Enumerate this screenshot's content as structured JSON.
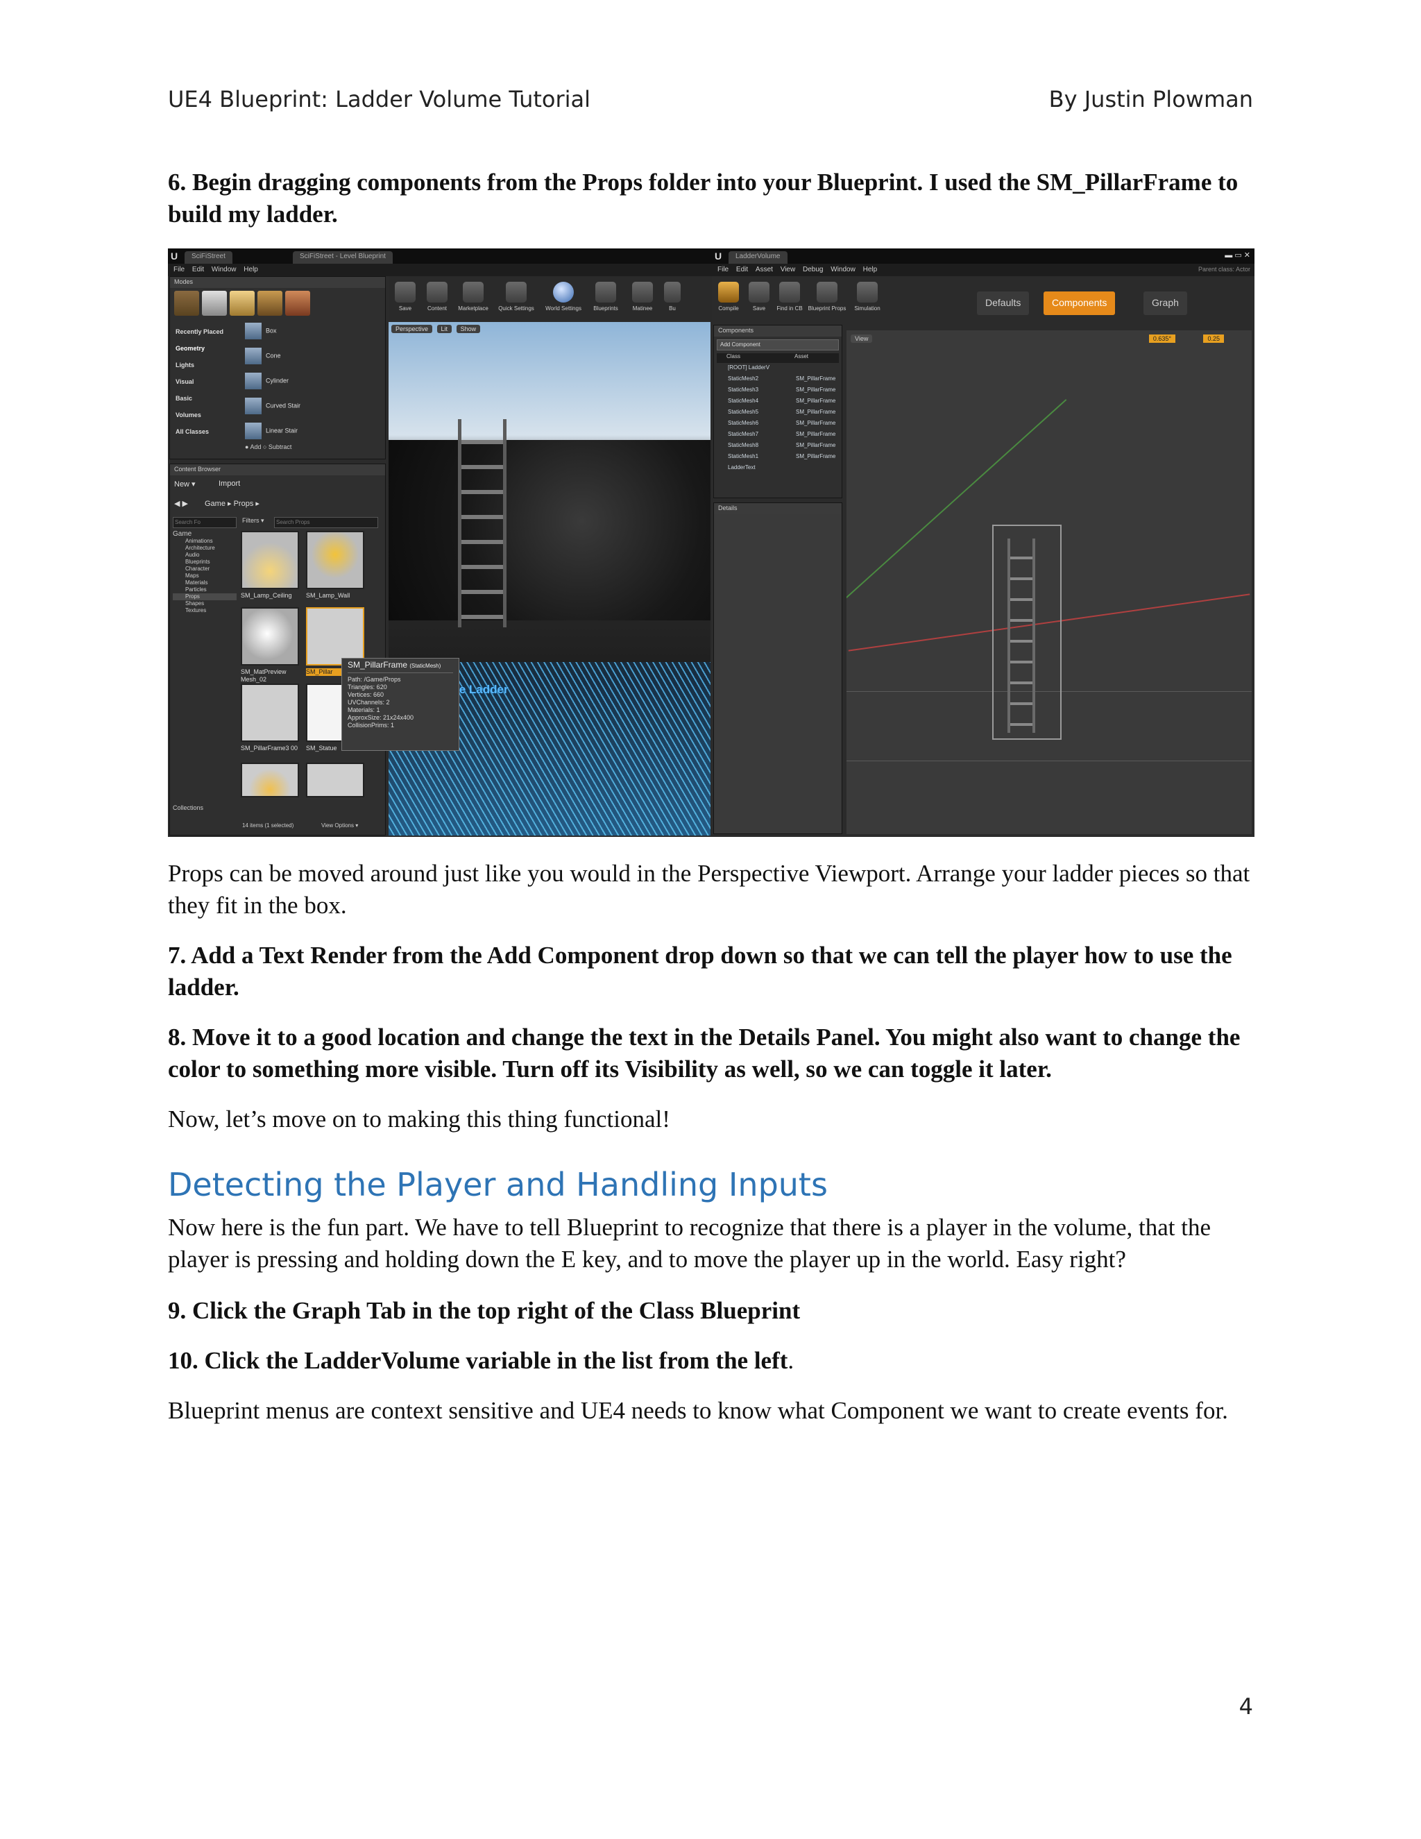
{
  "header": {
    "title": "UE4 Blueprint: Ladder Volume Tutorial",
    "author": "By Justin Plowman"
  },
  "step6": "6. Begin dragging components from the Props folder into your Blueprint. I used the SM_PillarFrame to build my ladder.",
  "para_props": "Props can be moved around just like you would in the Perspective Viewport. Arrange your ladder pieces so that they fit in the box.",
  "step7": "7. Add a Text Render from the Add Component drop down so that we can tell the player how to use the ladder.",
  "step8": "8. Move it to a good location and change the text in the Details Panel. You might also want to change the color to something more visible. Turn off its Visibility as well, so we can toggle it later.",
  "para_now": "Now, let’s move on to making this thing functional!",
  "heading": "Detecting the Player and Handling Inputs",
  "para_fun": "Now here is the fun part. We have to tell Blueprint to recognize that there is a player in the volume, that the player is pressing and holding down the E key, and to move the player up in the world. Easy right?",
  "step9": "9. Click the Graph Tab in the top right of the Class Blueprint",
  "step10_bold": "10. Click the LadderVolume variable in the list from the left",
  "step10_tail": ".",
  "para_context": "Blueprint menus are context sensitive and UE4 needs to know what Component we want to create events for.",
  "page_number": "4",
  "screenshot": {
    "left_window": {
      "tabs": [
        "SciFiStreet",
        "SciFiStreet - Level Blueprint"
      ],
      "menu": [
        "File",
        "Edit",
        "Window",
        "Help"
      ],
      "modes_label": "Modes",
      "categories": [
        "Recently Placed",
        "Geometry",
        "Lights",
        "Visual",
        "Basic",
        "Volumes",
        "All Classes"
      ],
      "shapes": [
        "Box",
        "Cone",
        "Cylinder",
        "Curved Stair",
        "Linear Stair"
      ],
      "add_subtract": "● Add   ○ Subtract",
      "toolbar": [
        "Save",
        "Content",
        "Marketplace",
        "Quick Settings",
        "World Settings",
        "Blueprints",
        "Matinee",
        "Bu"
      ],
      "content_browser_label": "Content Browser",
      "new_label": "New ▾",
      "import_label": "Import",
      "path": "Game ▸ Props ▸",
      "search_placeholder": "Search Fo",
      "filters_label": "Filters ▾",
      "search_props": "Search Props",
      "folders": [
        "Game",
        "Animations",
        "Architecture",
        "Audio",
        "Blueprints",
        "Character",
        "Maps",
        "Materials",
        "Particles",
        "Props",
        "Shapes",
        "Textures"
      ],
      "assets": [
        "SM_Lamp_Ceiling",
        "SM_Lamp_Wall",
        "SM_MatPreview Mesh_02",
        "SM_Pillar",
        "SM_PillarFrame3 00",
        "SM_Statue"
      ],
      "status": "14 items (1 selected)",
      "view_options": "View Options ▾",
      "collections": "Collections",
      "viewport_buttons": [
        "Perspective",
        "Lit",
        "Show"
      ],
      "viewport_text": "ress E To Use Ladder",
      "tooltip": {
        "title": "SM_PillarFrame",
        "type": "(StaticMesh)",
        "lines": [
          "Path: /Game/Props",
          "Triangles: 620",
          "Vertices: 660",
          "UVChannels: 2",
          "Materials: 1",
          "ApproxSize: 21x24x400",
          "CollisionPrims: 1"
        ]
      }
    },
    "right_window": {
      "tabs": [
        "LadderVolume"
      ],
      "menu": [
        "File",
        "Edit",
        "Asset",
        "View",
        "Debug",
        "Window",
        "Help"
      ],
      "parent_class": "Parent class: Actor",
      "toolbar": [
        "Compile",
        "Save",
        "Find in CB",
        "Blueprint Props",
        "Simulation"
      ],
      "mode_tabs": [
        "Defaults",
        "Components",
        "Graph"
      ],
      "components_label": "Components",
      "add_component": "Add Component",
      "col_class": "Class",
      "col_asset": "Asset",
      "rows": [
        {
          "name": "[ROOT] LadderV",
          "asset": ""
        },
        {
          "name": "StaticMesh2",
          "asset": "SM_PillarFrame"
        },
        {
          "name": "StaticMesh3",
          "asset": "SM_PillarFrame"
        },
        {
          "name": "StaticMesh4",
          "asset": "SM_PillarFrame"
        },
        {
          "name": "StaticMesh5",
          "asset": "SM_PillarFrame"
        },
        {
          "name": "StaticMesh6",
          "asset": "SM_PillarFrame"
        },
        {
          "name": "StaticMesh7",
          "asset": "SM_PillarFrame"
        },
        {
          "name": "StaticMesh8",
          "asset": "SM_PillarFrame"
        },
        {
          "name": "StaticMesh1",
          "asset": "SM_PillarFrame"
        },
        {
          "name": "LadderText",
          "asset": ""
        }
      ],
      "details_label": "Details",
      "view_label": "View",
      "angle_value": "0.635°",
      "scale_value": "0.25"
    }
  }
}
